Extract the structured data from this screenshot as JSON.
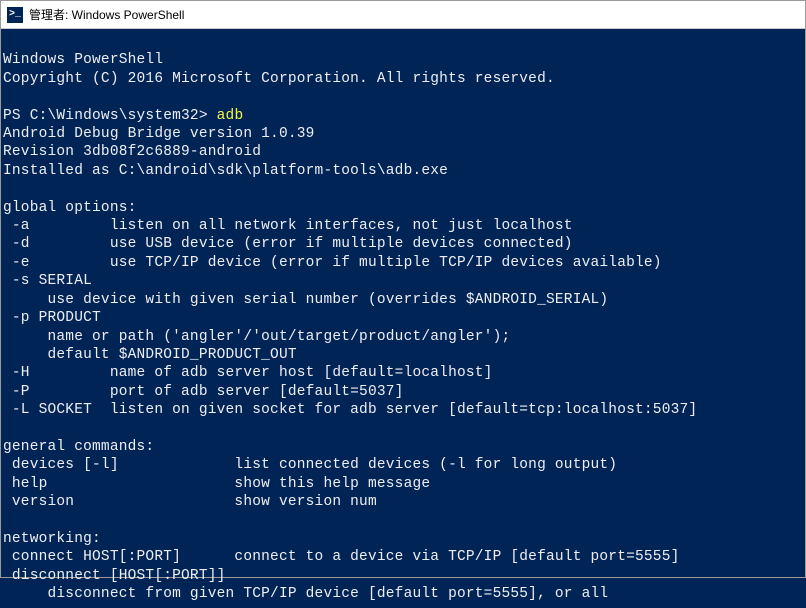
{
  "window": {
    "title": "管理者: Windows PowerShell",
    "icon_label": ">_"
  },
  "terminal": {
    "header1": "Windows PowerShell",
    "header2": "Copyright (C) 2016 Microsoft Corporation. All rights reserved.",
    "prompt": "PS C:\\Windows\\system32> ",
    "command": "adb",
    "adb_version": "Android Debug Bridge version 1.0.39",
    "revision": "Revision 3db08f2c6889-android",
    "installed": "Installed as C:\\android\\sdk\\platform-tools\\adb.exe",
    "global_header": "global options:",
    "opt_a": " -a         listen on all network interfaces, not just localhost",
    "opt_d": " -d         use USB device (error if multiple devices connected)",
    "opt_e": " -e         use TCP/IP device (error if multiple TCP/IP devices available)",
    "opt_s1": " -s SERIAL",
    "opt_s2": "     use device with given serial number (overrides $ANDROID_SERIAL)",
    "opt_p1": " -p PRODUCT",
    "opt_p2": "     name or path ('angler'/'out/target/product/angler');",
    "opt_p3": "     default $ANDROID_PRODUCT_OUT",
    "opt_H": " -H         name of adb server host [default=localhost]",
    "opt_P": " -P         port of adb server [default=5037]",
    "opt_L": " -L SOCKET  listen on given socket for adb server [default=tcp:localhost:5037]",
    "general_header": "general commands:",
    "gen_devices": " devices [-l]             list connected devices (-l for long output)",
    "gen_help": " help                     show this help message",
    "gen_version": " version                  show version num",
    "net_header": "networking:",
    "net_connect": " connect HOST[:PORT]      connect to a device via TCP/IP [default port=5555]",
    "net_disc1": " disconnect [HOST[:PORT]]",
    "net_disc2": "     disconnect from given TCP/IP device [default port=5555], or all"
  }
}
